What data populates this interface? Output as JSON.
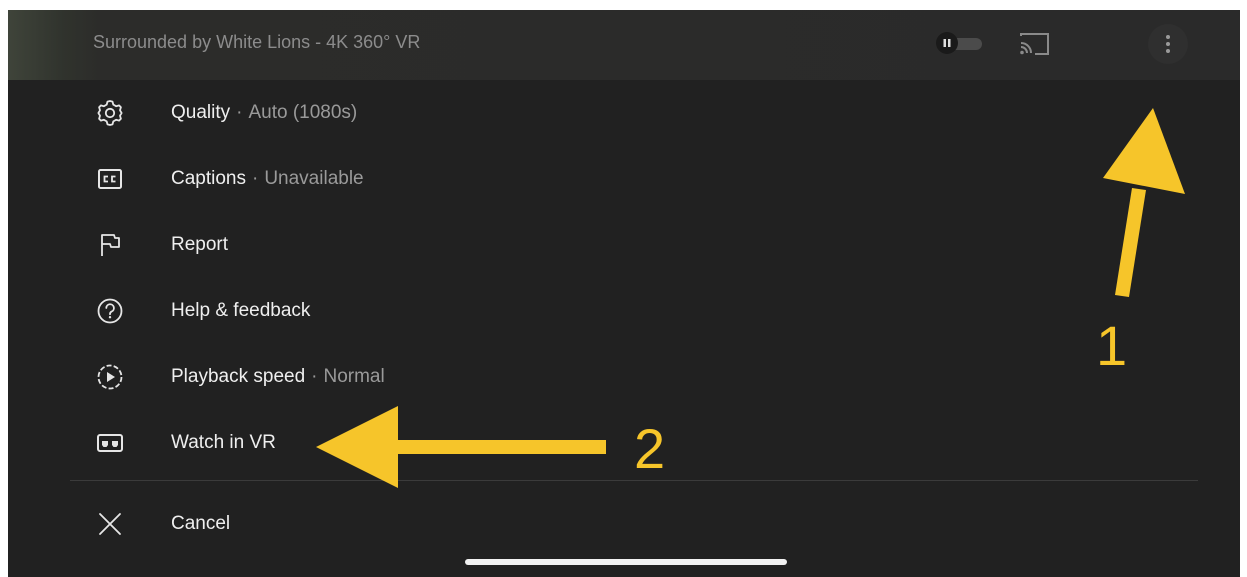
{
  "header": {
    "title": "Surrounded by White Lions - 4K 360° VR",
    "icons": {
      "autoplay": "autoplay-toggle-icon",
      "cast": "cast-icon",
      "more": "more-vert-icon"
    }
  },
  "menu": {
    "items": [
      {
        "label": "Quality",
        "sub": "Auto (1080s)",
        "icon": "gear-icon"
      },
      {
        "label": "Captions",
        "sub": "Unavailable",
        "icon": "closed-captions-icon"
      },
      {
        "label": "Report",
        "sub": "",
        "icon": "flag-icon"
      },
      {
        "label": "Help & feedback",
        "sub": "",
        "icon": "help-circle-icon"
      },
      {
        "label": "Playback speed",
        "sub": "Normal",
        "icon": "playback-speed-icon"
      },
      {
        "label": "Watch in VR",
        "sub": "",
        "icon": "vr-headset-icon"
      }
    ],
    "cancel": {
      "label": "Cancel",
      "icon": "close-icon"
    }
  },
  "annotations": {
    "arrow1_number": "1",
    "arrow2_number": "2",
    "color": "#f6c52a"
  },
  "colors": {
    "background": "#212121",
    "text": "#efefef",
    "subtext": "#9a9a9a"
  }
}
